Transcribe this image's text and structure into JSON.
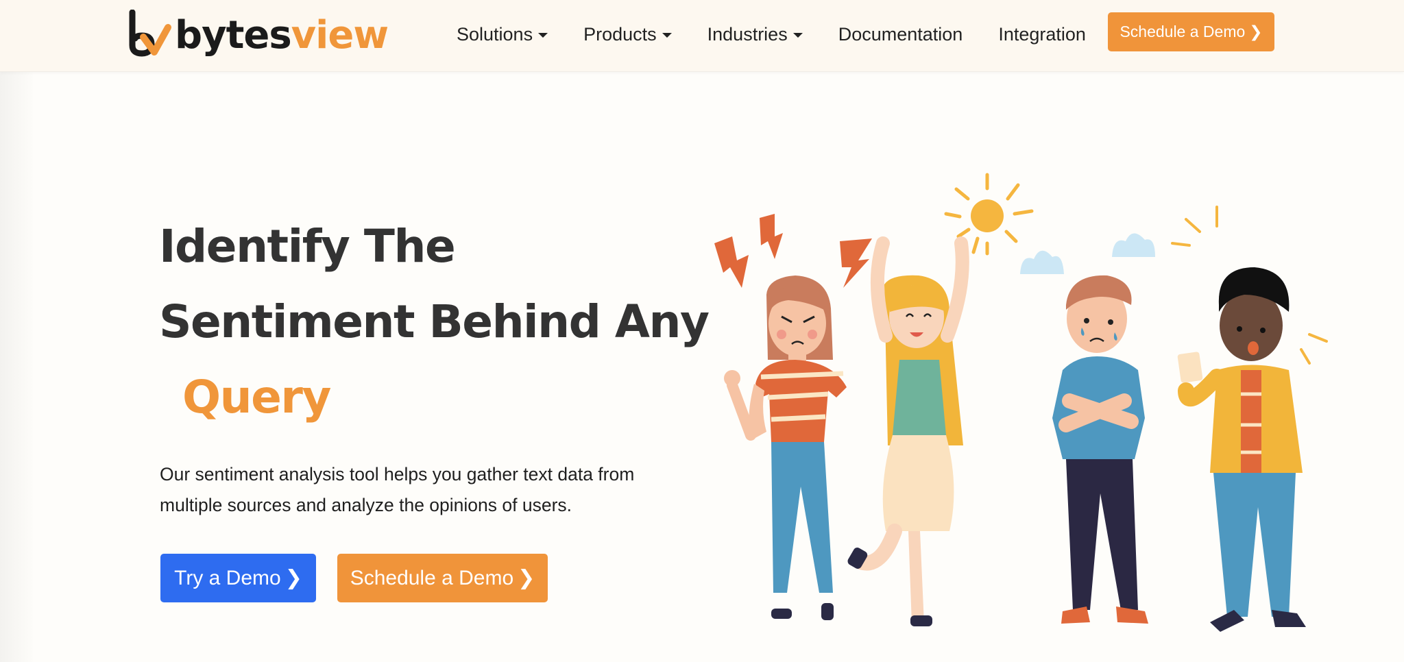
{
  "brand": {
    "name_dark": "bytes",
    "name_accent": "view",
    "colors": {
      "accent": "#f0963a",
      "dark": "#1b1b1b",
      "primary_blue": "#2e6cf0"
    }
  },
  "navbar": {
    "items": [
      {
        "label": "Solutions",
        "has_dropdown": true
      },
      {
        "label": "Products",
        "has_dropdown": true
      },
      {
        "label": "Industries",
        "has_dropdown": true
      },
      {
        "label": "Documentation",
        "has_dropdown": false
      },
      {
        "label": "Integration",
        "has_dropdown": false
      }
    ],
    "cta_label": "Schedule a Demo",
    "cta_icon": "chevron-right-icon"
  },
  "hero": {
    "title_line1": "Identify The",
    "title_line2": "Sentiment Behind Any",
    "title_accent": "Query",
    "description": "Our sentiment analysis tool helps you gather text data from multiple sources and analyze the opinions of users.",
    "primary_button": "Try a Demo",
    "secondary_button": "Schedule a Demo",
    "illustration": {
      "description": "Four cartoon people showing different emotions: angry girl with lightning bolts, happy girl with sun, sad crying boy with clouds, surprised boy holding phone",
      "elements": [
        "lightning-bolts",
        "sun",
        "clouds",
        "angry-girl",
        "happy-girl",
        "sad-boy",
        "surprised-boy"
      ]
    }
  }
}
